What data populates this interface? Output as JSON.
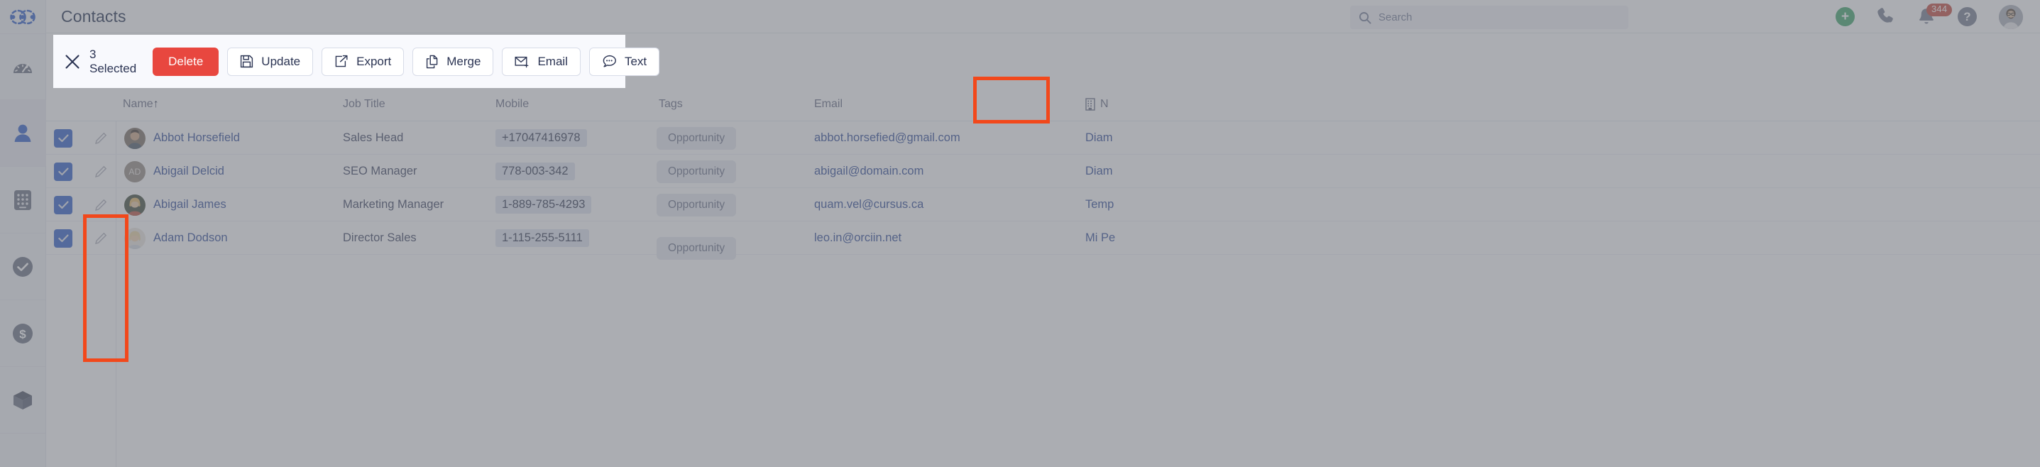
{
  "brand": {
    "logo_icon": "chain-links-logo"
  },
  "sidebar": {
    "items": [
      {
        "name": "dashboard",
        "icon": "gauge-icon",
        "active": false
      },
      {
        "name": "contacts",
        "icon": "person-icon",
        "active": true
      },
      {
        "name": "dialer",
        "icon": "keypad-grid-icon",
        "active": false
      },
      {
        "name": "tasks",
        "icon": "check-circle-icon",
        "active": false
      },
      {
        "name": "deals",
        "icon": "dollar-circle-icon",
        "active": false
      },
      {
        "name": "products",
        "icon": "box-icon",
        "active": false
      }
    ]
  },
  "header": {
    "title": "Contacts",
    "search": {
      "placeholder": "Search",
      "value": "",
      "icon": "search-icon"
    },
    "add_icon": "plus-circle-icon",
    "phone_icon": "phone-icon",
    "bell_icon": "bell-icon",
    "notification_count": "344",
    "help_icon": "question-circle-icon",
    "avatar_icon": "user-avatar"
  },
  "action_bar": {
    "close_icon": "close-icon",
    "selected_label": "3 Selected",
    "buttons": [
      {
        "label": "Delete",
        "icon": "",
        "style": "danger"
      },
      {
        "label": "Update",
        "icon": "floppy-disk-icon",
        "style": "default"
      },
      {
        "label": "Export",
        "icon": "share-export-icon",
        "style": "default"
      },
      {
        "label": "Merge",
        "icon": "copy-pages-icon",
        "style": "default"
      },
      {
        "label": "Email",
        "icon": "envelope-plus-icon",
        "style": "default"
      },
      {
        "label": "Text",
        "icon": "chat-bubble-icon",
        "style": "default"
      }
    ]
  },
  "table": {
    "columns": [
      {
        "label": "Name",
        "sort": "↑"
      },
      {
        "label": "Job Title",
        "sort": ""
      },
      {
        "label": "Mobile",
        "sort": ""
      },
      {
        "label": "Tags",
        "sort": ""
      },
      {
        "label": "Email",
        "sort": ""
      },
      {
        "label": "N",
        "sort": "",
        "icon": "building-icon"
      }
    ],
    "rows": [
      {
        "checked": true,
        "avatar": "photo-male",
        "initials": "",
        "name": "Abbot Horsefield",
        "job_title": "Sales Head",
        "mobile": "+17047416978",
        "tag": "Opportunity",
        "email": "abbot.horsefied@gmail.com",
        "next_step": "Diam"
      },
      {
        "checked": true,
        "avatar": "initials",
        "initials": "AD",
        "name": "Abigail Delcid",
        "job_title": "SEO Manager",
        "mobile": "778-003-342",
        "tag": "Opportunity",
        "email": "abigail@domain.com",
        "next_step": "Diam"
      },
      {
        "checked": true,
        "avatar": "photo-girl",
        "initials": "",
        "name": "Abigail James",
        "job_title": "Marketing Manager",
        "mobile": "1-889-785-4293",
        "tag": "Opportunity",
        "email": "quam.vel@cursus.ca",
        "next_step": "Temp"
      },
      {
        "checked": false,
        "avatar": "photo-blonde",
        "initials": "",
        "name": "Adam Dodson",
        "job_title": "Director Sales",
        "mobile": "1-115-255-5111",
        "tag": "Opportunity",
        "email": "leo.in@orciin.net",
        "next_step": "Mi Pe"
      }
    ]
  },
  "colors": {
    "danger": "#e8473f",
    "accent_blue": "#1b4fc4",
    "link": "#1b3a8f",
    "highlight_box": "#f2481b",
    "badge_red": "#c0392b",
    "add_green": "#2f9e5e"
  }
}
